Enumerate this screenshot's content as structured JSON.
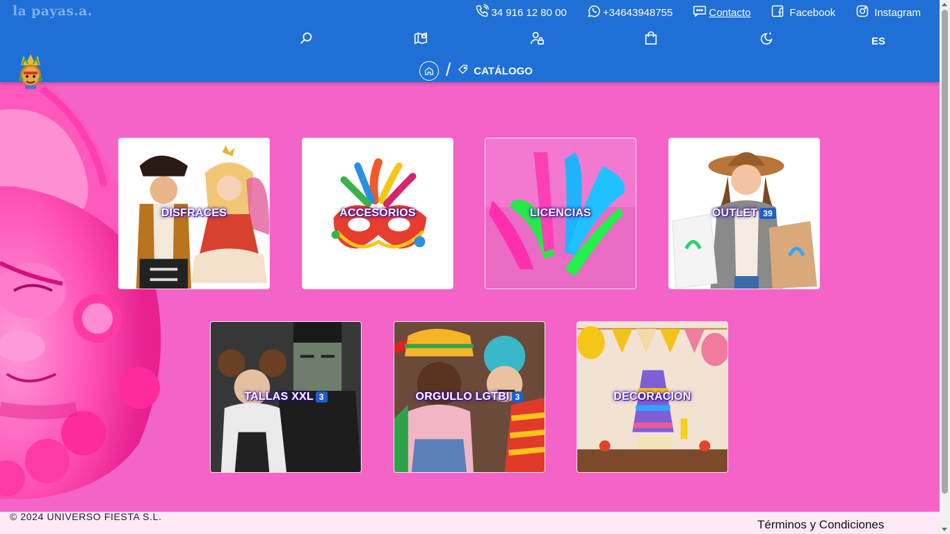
{
  "header": {
    "brand": "la payas.a.",
    "contacts": {
      "phone": "34 916 12 80 00",
      "whatsapp": "+34643948755",
      "contact": "Contacto",
      "facebook": "Facebook",
      "instagram": "Instagram"
    },
    "language": "ES",
    "breadcrumb": {
      "current": "CATÁLOGO"
    }
  },
  "categories": [
    {
      "label": "DISFRACES",
      "badge": ""
    },
    {
      "label": "ACCESORIOS",
      "badge": ""
    },
    {
      "label": "LICENCIAS",
      "badge": ""
    },
    {
      "label": "OUTLET",
      "badge": "39"
    },
    {
      "label": "TALLAS XXL",
      "badge": "3"
    },
    {
      "label": "ORGULLO LGTBI",
      "badge": "3"
    },
    {
      "label": "DECORACION",
      "badge": ""
    }
  ],
  "footer": {
    "copyright": "© 2024 UNIVERSO FIESTA S.L.",
    "terms": "Términos y Condiciones"
  },
  "colors": {
    "header_bg": "#1f6fd6",
    "page_bg": "#f463c8",
    "footer_bg": "#fde8f5",
    "badge_bg": "#1e5fd0"
  }
}
